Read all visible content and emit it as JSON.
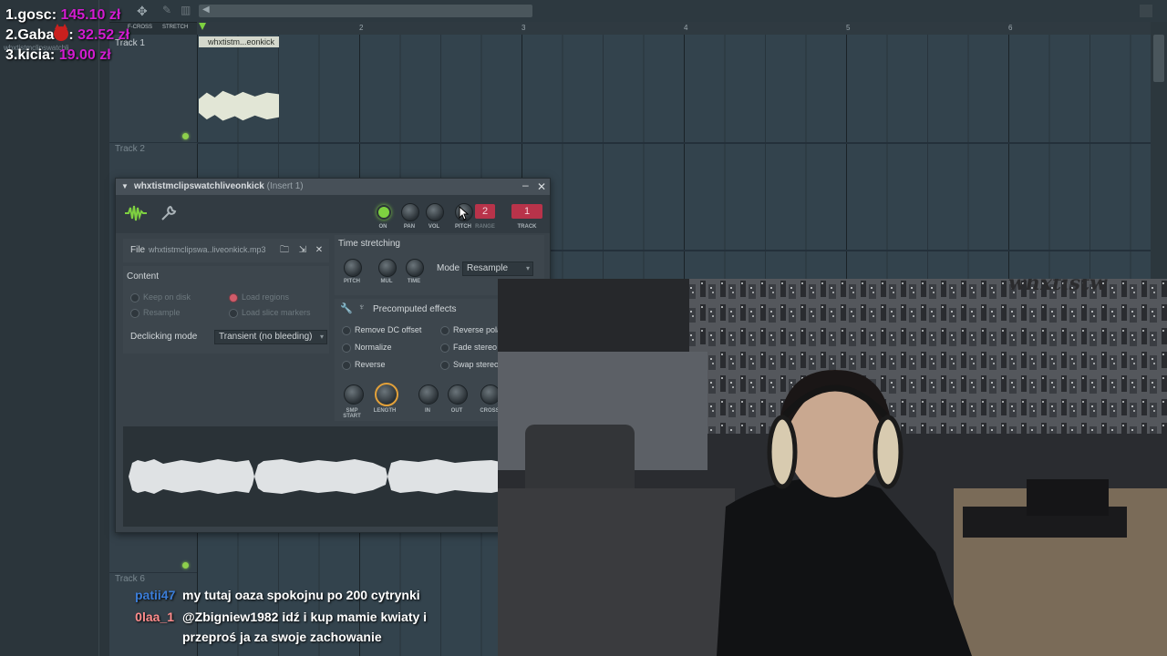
{
  "leaderboard": [
    {
      "rank_name": "1.gosc:",
      "amount": "145.10 zł"
    },
    {
      "rank_name": "2.Gaba",
      "emoji": "devil-icon",
      "sep": ":",
      "amount": "32.52 zł"
    },
    {
      "rank_name": "3.kicia:",
      "amount": "19.00 zł"
    }
  ],
  "playlist": {
    "ruler_ticks": [
      "2",
      "3",
      "4",
      "5",
      "6"
    ],
    "tracks": [
      "Track 1",
      "Track 2",
      "Track 6"
    ],
    "clip_name": "whxtistm...eonkick",
    "toolbar_snap": "F-CROSS",
    "toolbar_stretch": "STRETCH",
    "browser_item": "whxtistmclipswatchli"
  },
  "channel_window": {
    "title": "whxtistmclipswatchliveonkick",
    "insert": "(Insert 1)",
    "knobs": {
      "on": "ON",
      "pan": "PAN",
      "vol": "VOL",
      "pitch": "PITCH",
      "range": "RANGE",
      "track": "TRACK"
    },
    "range_value": "2",
    "track_value": "1",
    "file_label": "File",
    "file_name": "whxtistmclipswa..liveonkick.mp3",
    "content_label": "Content",
    "content_options": [
      "Keep on disk",
      "Load regions",
      "Resample",
      "Load slice markers"
    ],
    "declicking_label": "Declicking mode",
    "declicking_value": "Transient (no bleeding)",
    "time_stretch": {
      "title": "Time stretching",
      "knobs": [
        "PITCH",
        "MUL",
        "TIME"
      ],
      "mode_label": "Mode",
      "mode_value": "Resample"
    },
    "precomputed": {
      "title": "Precomputed effects",
      "options": [
        "Remove DC offset",
        "Reverse pola",
        "Normalize",
        "Fade stereo",
        "Reverse",
        "Swap stereo"
      ],
      "knobs": [
        "SMP START",
        "LENGTH",
        "IN",
        "OUT",
        "CROSS"
      ]
    }
  },
  "chat": [
    {
      "user": "patii47",
      "user_color": "#3b7dd8",
      "msg": "my tutaj oaza spokojnu po 200 cytrynki"
    },
    {
      "user": "0laa_1",
      "user_color": "#ff8c8c",
      "msg": "@Zbigniew1982 idź i kup mamie kwiaty i",
      "msg2": "przeproś ja za swoje zachowanie"
    }
  ],
  "webcam_sign": "whxtistw",
  "colors": {
    "accent_led": "#7ed140",
    "red_box": "#b8334a",
    "leaderboard_amount": "#d21cd0"
  }
}
